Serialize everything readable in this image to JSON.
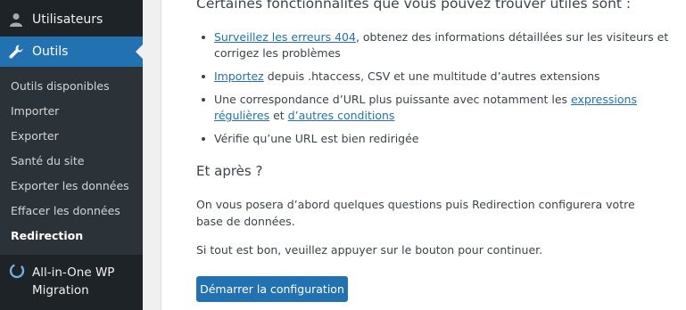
{
  "sidebar": {
    "users_label": "Utilisateurs",
    "tools_label": "Outils",
    "submenu": [
      "Outils disponibles",
      "Importer",
      "Exporter",
      "Santé du site",
      "Exporter les données",
      "Effacer les données",
      "Redirection"
    ],
    "current_submenu": "Redirection",
    "plugin_label_line1": "All-in-One WP",
    "plugin_label_line2": "Migration"
  },
  "main": {
    "intro": "Certaines fonctionnalités que vous pouvez trouver utiles sont :",
    "features": {
      "f1_link": "Surveillez les erreurs 404",
      "f1_text": ", obtenez des informations détaillées sur les visiteurs et corrigez les problèmes",
      "f2_link": "Importez",
      "f2_text": " depuis .htaccess, CSV et une multitude d’autres extensions",
      "f3_text": "Une correspondance d’URL plus puissante avec notamment les ",
      "f3_link1": "expressions régulières",
      "f3_mid": " et ",
      "f3_link2": "d’autres conditions",
      "f4_text": "Vérifie qu’une URL est bien redirigée"
    },
    "after_title": "Et après ?",
    "paragraph1": "On vous posera d’abord quelques questions puis Redirection configurera votre base de données.",
    "paragraph2": "Si tout est bon, veuillez appuyer sur le bouton pour continuer.",
    "start_button": "Démarrer la configuration"
  },
  "colors": {
    "sidebar_bg": "#1d2327",
    "submenu_bg": "#2c3338",
    "accent": "#2271b1",
    "link": "#2271b1"
  }
}
